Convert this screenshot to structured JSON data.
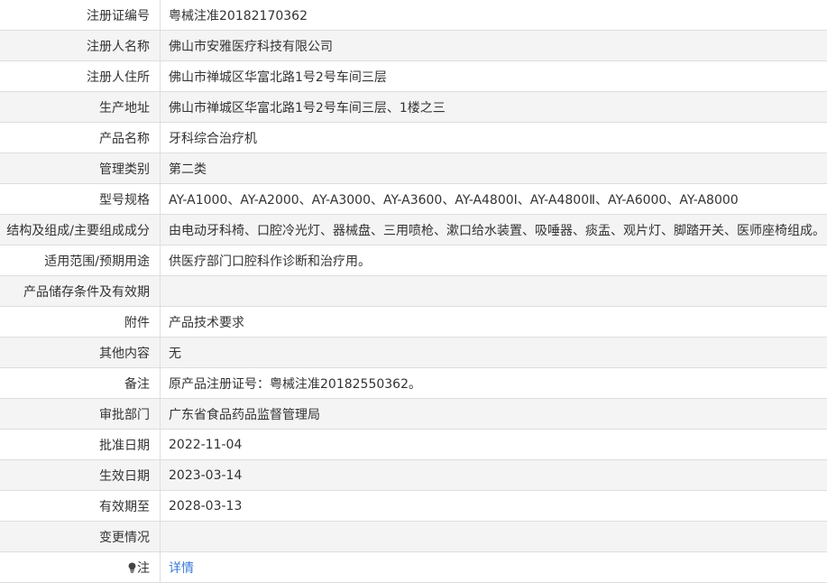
{
  "rows": [
    {
      "label": "注册证编号",
      "value": "粤械注准20182170362"
    },
    {
      "label": "注册人名称",
      "value": "佛山市安雅医疗科技有限公司"
    },
    {
      "label": "注册人住所",
      "value": "佛山市禅城区华富北路1号2号车间三层"
    },
    {
      "label": "生产地址",
      "value": "佛山市禅城区华富北路1号2号车间三层、1楼之三"
    },
    {
      "label": "产品名称",
      "value": "牙科综合治疗机"
    },
    {
      "label": "管理类别",
      "value": "第二类"
    },
    {
      "label": "型号规格",
      "value": "AY-A1000、AY-A2000、AY-A3000、AY-A3600、AY-A4800Ⅰ、AY-A4800Ⅱ、AY-A6000、AY-A8000"
    },
    {
      "label": "结构及组成/主要组成成分",
      "value": "由电动牙科椅、口腔冷光灯、器械盘、三用喷枪、漱口给水装置、吸唾器、痰盂、观片灯、脚踏开关、医师座椅组成。"
    },
    {
      "label": "适用范围/预期用途",
      "value": "供医疗部门口腔科作诊断和治疗用。"
    },
    {
      "label": "产品储存条件及有效期",
      "value": ""
    },
    {
      "label": "附件",
      "value": "产品技术要求"
    },
    {
      "label": "其他内容",
      "value": "无"
    },
    {
      "label": "备注",
      "value": "原产品注册证号：粤械注准20182550362。"
    },
    {
      "label": "审批部门",
      "value": "广东省食品药品监督管理局"
    },
    {
      "label": "批准日期",
      "value": "2022-11-04"
    },
    {
      "label": "生效日期",
      "value": "2023-03-14"
    },
    {
      "label": "有效期至",
      "value": "2028-03-13"
    },
    {
      "label": "变更情况",
      "value": ""
    }
  ],
  "note_row": {
    "label": "注",
    "link_text": "详情",
    "icon": "lightbulb-icon"
  },
  "colors": {
    "border": "#dedede",
    "zebra": "#f4f4f4",
    "text": "#333333",
    "link": "#3a7bd5"
  }
}
